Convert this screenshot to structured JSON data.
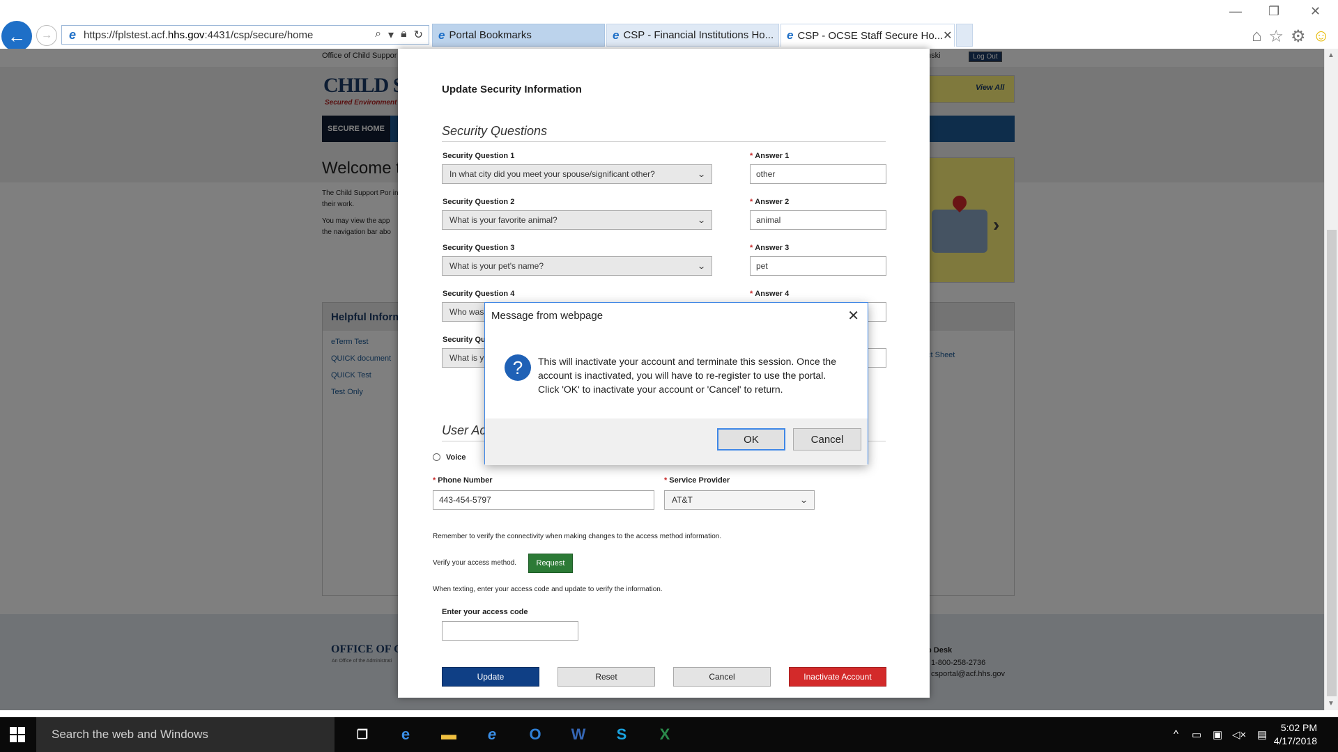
{
  "browser": {
    "url_prefix": "https://fplstest.acf.",
    "url_domain": "hhs.gov",
    "url_suffix": ":4431/csp/secure/home",
    "tabs": [
      {
        "label": "Portal Bookmarks"
      },
      {
        "label": "CSP - Financial Institutions Ho..."
      },
      {
        "label": "CSP - OCSE Staff Secure Ho..."
      }
    ]
  },
  "background_page": {
    "top_bar_text": "Office of Child Suppor",
    "user_text": "nski",
    "logout_label": "Log Out",
    "logo_text": "CHILD SUP",
    "logo_sub": "Secured Environment",
    "view_all": "View All",
    "nav_home": "SECURE HOME",
    "welcome": "Welcome t",
    "para1": "The Child Support Por in their work.",
    "para2": "You may view the app the navigation bar abo",
    "helpful_heading": "Helpful Inform",
    "helpful_links": [
      "eTerm Test",
      "QUICK document",
      "QUICK Test",
      "Test Only"
    ],
    "fact_sheet": "ct Sheet",
    "footer_logo": "OFFICE OF CHIL",
    "footer_logo_sub": "An Office of the Administrati",
    "help_desk": "p Desk",
    "help_phone": "1-800-258-2736",
    "help_email": "csportal@acf.hhs.gov"
  },
  "modal": {
    "title": "Update Security Information",
    "security_section": "Security Questions",
    "questions": [
      {
        "label": "Security Question 1",
        "value": "In what city did you meet your spouse/significant other?",
        "answer_label": "Answer 1",
        "answer": "other"
      },
      {
        "label": "Security Question 2",
        "value": "What is your favorite animal?",
        "answer_label": "Answer 2",
        "answer": "animal"
      },
      {
        "label": "Security Question 3",
        "value": "What is your pet's name?",
        "answer_label": "Answer 3",
        "answer": "pet"
      },
      {
        "label": "Security Question 4",
        "value": "Who was",
        "answer_label": "Answer 4",
        "answer": ""
      },
      {
        "label": "Security Qu",
        "value": "What is y",
        "answer_label": "",
        "answer": ""
      }
    ],
    "user_access_section": "User Ac",
    "voice_label": "Voice",
    "phone_label": "Phone Number",
    "phone_value": "443-454-5797",
    "provider_label": "Service Provider",
    "provider_value": "AT&T",
    "verify_note": "Remember to verify the connectivity when making changes to the access method information.",
    "verify_label": "Verify your access method.",
    "request_button": "Request",
    "texting_note": "When texting, enter your access code and update to verify the information.",
    "access_code_label": "Enter your access code",
    "access_code_value": "",
    "buttons": {
      "update": "Update",
      "reset": "Reset",
      "cancel": "Cancel",
      "inactivate": "Inactivate Account"
    }
  },
  "dialog": {
    "title": "Message from webpage",
    "message": "This will inactivate your account and terminate this session. Once the account is inactivated, you will have to re-register to use the portal. Click 'OK' to inactivate your account or 'Cancel' to return.",
    "ok": "OK",
    "cancel": "Cancel"
  },
  "taskbar": {
    "search_placeholder": "Search the web and Windows",
    "time": "5:02 PM",
    "date": "4/17/2018"
  },
  "colors": {
    "accent_blue": "#0f3f85",
    "danger_red": "#d32a2a",
    "request_green": "#2c7a36",
    "dialog_border": "#3f87e6"
  }
}
